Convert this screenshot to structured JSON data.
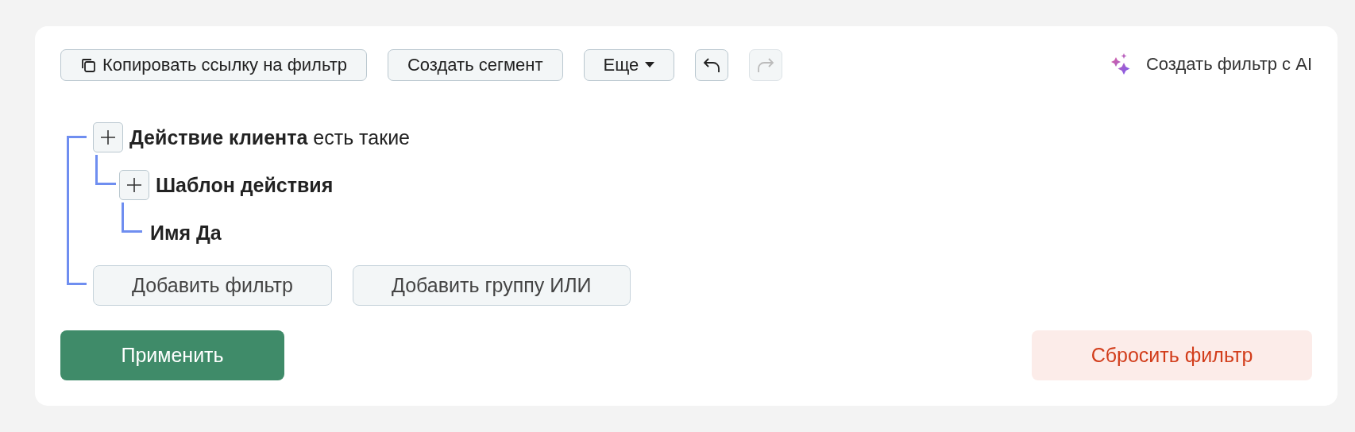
{
  "toolbar": {
    "buttons": [
      {
        "kind": "copy",
        "label": "Копировать ссылку на фильтр",
        "disabled": false
      },
      {
        "kind": "text",
        "label": "Создать сегмент",
        "disabled": false
      },
      {
        "kind": "dropdown",
        "label": "Еще",
        "disabled": false
      },
      {
        "kind": "undo",
        "disabled": false
      },
      {
        "kind": "redo",
        "disabled": true
      }
    ],
    "ai_button": {
      "label": "Создать фильтр с AI"
    }
  },
  "filter_tree": {
    "nodes": [
      {
        "label": "**Действие клиента** есть такие",
        "add_button": true,
        "children": [
          {
            "label": "Шаблон действия",
            "add_button": true,
            "children": [
              {
                "label": "Имя Да",
                "add_button": false
              }
            ]
          }
        ]
      }
    ],
    "actions": [
      "Добавить фильтр",
      "Добавить группу ИЛИ"
    ]
  },
  "apply_button": "Применить",
  "reset_button": "Сбросить фильтр"
}
